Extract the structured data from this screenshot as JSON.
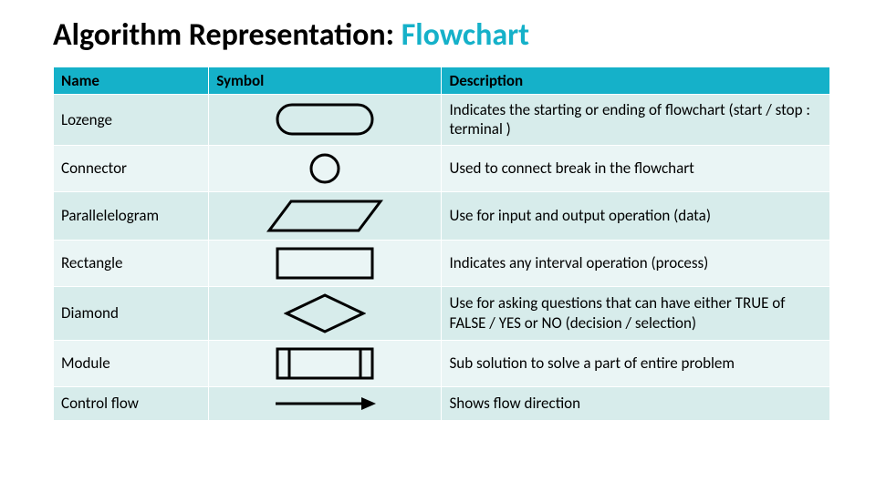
{
  "heading": {
    "plain": "Algorithm Representation: ",
    "accent": "Flowchart"
  },
  "columns": {
    "name": "Name",
    "symbol": "Symbol",
    "description": "Description"
  },
  "rows": [
    {
      "name": "Lozenge",
      "desc": "Indicates the starting or ending of flowchart (start / stop : terminal )"
    },
    {
      "name": "Connector",
      "desc": "Used to connect break in the flowchart"
    },
    {
      "name": "Parallelelogram",
      "desc": "Use for input and output operation (data)"
    },
    {
      "name": "Rectangle",
      "desc": "Indicates any interval operation (process)"
    },
    {
      "name": "Diamond",
      "desc": "Use for asking questions that can have either TRUE of FALSE / YES or NO (decision / selection)"
    },
    {
      "name": "Module",
      "desc": "Sub solution to solve a part of entire problem"
    },
    {
      "name": "Control flow",
      "desc": "Shows flow direction"
    }
  ]
}
